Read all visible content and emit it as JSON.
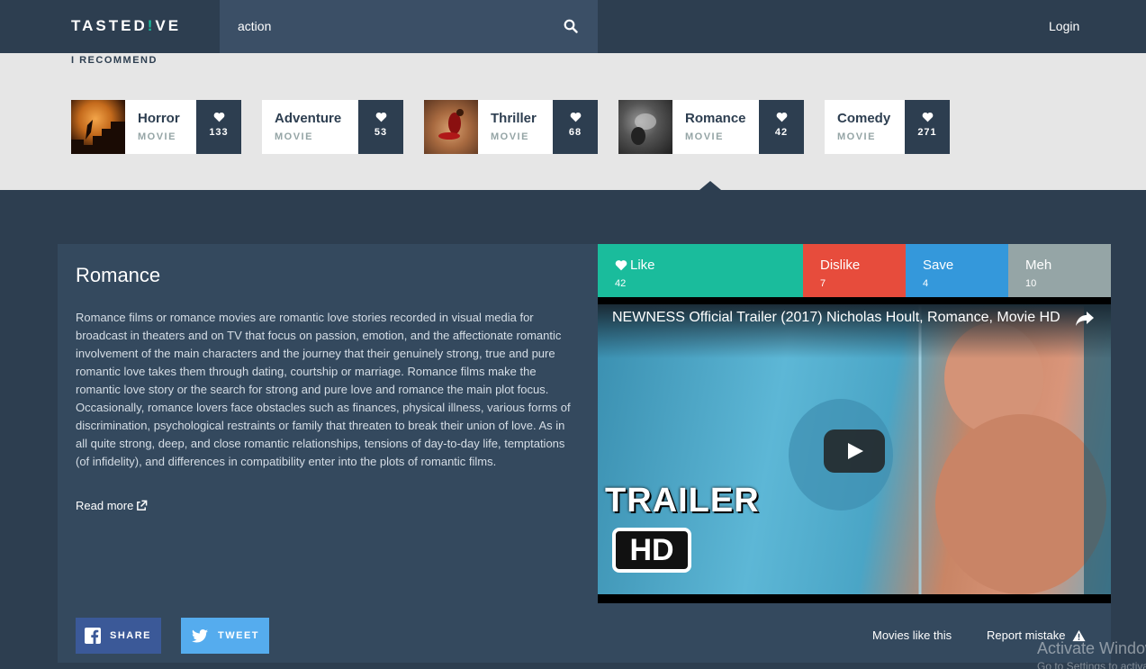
{
  "header": {
    "logo_part1": "TASTED",
    "logo_accent": "!",
    "logo_part2": "VE",
    "search_value": "action",
    "login_label": "Login"
  },
  "recommend": {
    "title": "I RECOMMEND",
    "cards": [
      {
        "name": "Horror",
        "type": "MOVIE",
        "likes": "133"
      },
      {
        "name": "Adventure",
        "type": "MOVIE",
        "likes": "53"
      },
      {
        "name": "Thriller",
        "type": "MOVIE",
        "likes": "68"
      },
      {
        "name": "Romance",
        "type": "MOVIE",
        "likes": "42"
      },
      {
        "name": "Comedy",
        "type": "MOVIE",
        "likes": "271"
      }
    ]
  },
  "detail": {
    "title": "Romance",
    "description": "Romance films or romance movies are romantic love stories recorded in visual media for broadcast in theaters and on TV that focus on passion, emotion, and the affectionate romantic involvement of the main characters and the journey that their genuinely strong, true and pure romantic love takes them through dating, courtship or marriage. Romance films make the romantic love story or the search for strong and pure love and romance the main plot focus. Occasionally, romance lovers face obstacles such as finances, physical illness, various forms of discrimination, psychological restraints or family that threaten to break their union of love. As in all quite strong, deep, and close romantic relationships, tensions of day-to-day life, temptations (of infidelity), and differences in compatibility enter into the plots of romantic films.",
    "read_more": "Read more",
    "votes": [
      {
        "label": "Like",
        "count": "42",
        "color": "#1abc9c"
      },
      {
        "label": "Dislike",
        "count": "7",
        "color": "#e74c3c"
      },
      {
        "label": "Save",
        "count": "4",
        "color": "#3498db"
      },
      {
        "label": "Meh",
        "count": "10",
        "color": "#95a5a6"
      }
    ],
    "video": {
      "title": "NEWNESS Official Trailer (2017) Nicholas Hoult, Romance, Movie HD",
      "trailer_text": "TRAILER",
      "hd_text": "HD"
    },
    "share_label": "SHARE",
    "tweet_label": "TWEET",
    "movies_like_this": "Movies like this",
    "report_mistake": "Report mistake"
  },
  "watermark": {
    "line1": "Activate Windows",
    "line2": "Go to Settings to activate Windows."
  }
}
